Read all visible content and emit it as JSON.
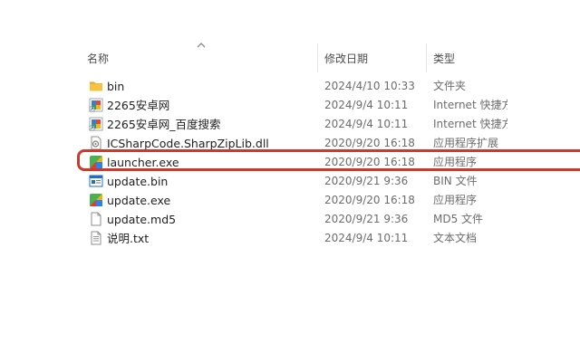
{
  "header": {
    "name_label": "名称",
    "date_label": "修改日期",
    "type_label": "类型"
  },
  "files": [
    {
      "name": "bin",
      "date": "2024/4/10 10:33",
      "type": "文件夹",
      "icon": "folder-icon"
    },
    {
      "name": "2265安卓网",
      "date": "2024/9/4 10:11",
      "type": "Internet 快捷方式",
      "icon": "internet-shortcut-icon"
    },
    {
      "name": "2265安卓网_百度搜索",
      "date": "2024/9/4 10:11",
      "type": "Internet 快捷方式",
      "icon": "internet-shortcut-icon"
    },
    {
      "name": "ICSharpCode.SharpZipLib.dll",
      "date": "2020/9/20 16:18",
      "type": "应用程序扩展",
      "icon": "dll-icon"
    },
    {
      "name": "launcher.exe",
      "date": "2020/9/20 16:18",
      "type": "应用程序",
      "icon": "exe-app-icon"
    },
    {
      "name": "update.bin",
      "date": "2020/9/21 9:36",
      "type": "BIN 文件",
      "icon": "bin-file-icon"
    },
    {
      "name": "update.exe",
      "date": "2020/9/20 16:18",
      "type": "应用程序",
      "icon": "exe-app-icon"
    },
    {
      "name": "update.md5",
      "date": "2020/9/21 9:36",
      "type": "MD5 文件",
      "icon": "blank-file-icon"
    },
    {
      "name": "说明.txt",
      "date": "2024/9/4 10:11",
      "type": "文本文档",
      "icon": "text-file-icon"
    }
  ],
  "colors": {
    "highlight_border": "#cc3a2b",
    "folder": "#f5c242"
  }
}
